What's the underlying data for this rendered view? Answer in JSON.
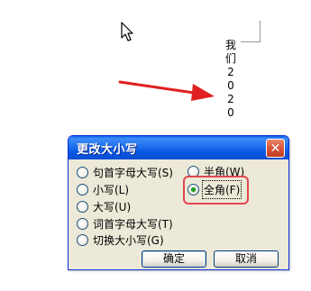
{
  "document": {
    "vertical_text": [
      "我",
      "们",
      "2",
      "0",
      "2",
      "0"
    ]
  },
  "dialog": {
    "title": "更改大小写",
    "close_label": "✕",
    "options": [
      {
        "label": "句首字母大写(S)",
        "checked": false
      },
      {
        "label": "小写(L)",
        "checked": false
      },
      {
        "label": "大写(U)",
        "checked": false
      },
      {
        "label": "词首字母大写(T)",
        "checked": false
      },
      {
        "label": "切换大小写(G)",
        "checked": false
      },
      {
        "label": "半角(W)",
        "checked": false
      },
      {
        "label": "全角(F)",
        "checked": true
      }
    ],
    "ok_label": "确定",
    "cancel_label": "取消"
  },
  "colors": {
    "title_bar": "#0a5fe8",
    "dialog_bg": "#ece9d8",
    "annotation_red": "#e0474f",
    "radio_checked": "#21a121"
  },
  "icons": [
    "mouse-pointer-icon",
    "red-arrow-icon",
    "close-icon"
  ]
}
